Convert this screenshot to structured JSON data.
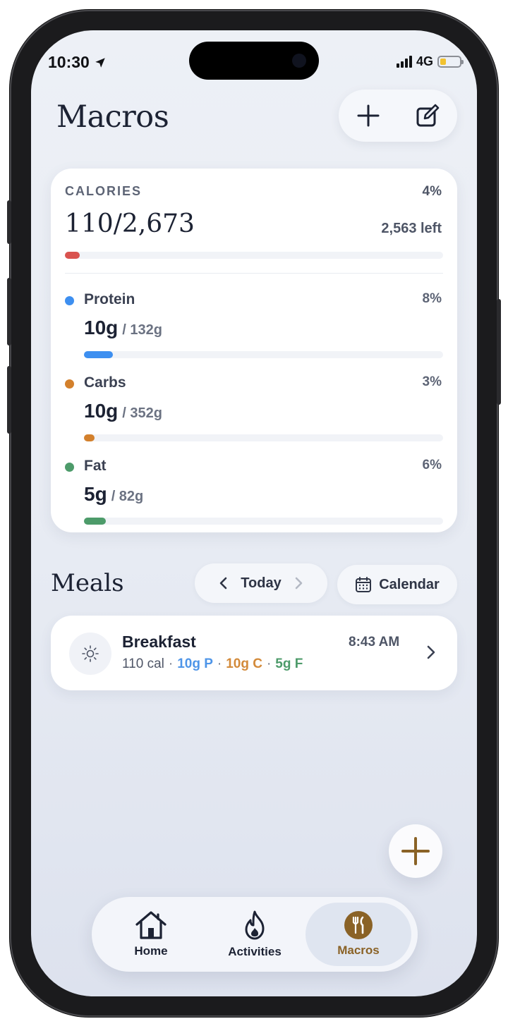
{
  "status_bar": {
    "time": "10:30",
    "network": "4G"
  },
  "header": {
    "title": "Macros"
  },
  "calories": {
    "label": "CALORIES",
    "percent": "4%",
    "value": "110/2,673",
    "left": "2,563 left",
    "progress": 0.04,
    "color": "#d9534f"
  },
  "macros": [
    {
      "name": "Protein",
      "percent": "8%",
      "amount": "10g",
      "target": "/ 132g",
      "progress": 0.08,
      "color": "#3d8ff0"
    },
    {
      "name": "Carbs",
      "percent": "3%",
      "amount": "10g",
      "target": "/ 352g",
      "progress": 0.03,
      "color": "#d3802c"
    },
    {
      "name": "Fat",
      "percent": "6%",
      "amount": "5g",
      "target": "/ 82g",
      "progress": 0.06,
      "color": "#4d9b6a"
    }
  ],
  "meals": {
    "title": "Meals",
    "date_label": "Today",
    "calendar_label": "Calendar",
    "items": [
      {
        "name": "Breakfast",
        "time": "8:43 AM",
        "cal": "110 cal",
        "protein": "10g P",
        "carbs": "10g C",
        "fat": "5g F"
      }
    ]
  },
  "tabbar": {
    "tabs": [
      {
        "label": "Home",
        "icon": "house-icon",
        "active": false
      },
      {
        "label": "Activities",
        "icon": "flame-icon",
        "active": false
      },
      {
        "label": "Macros",
        "icon": "fork-knife-icon",
        "active": true
      }
    ],
    "accent": "#8a6226"
  }
}
